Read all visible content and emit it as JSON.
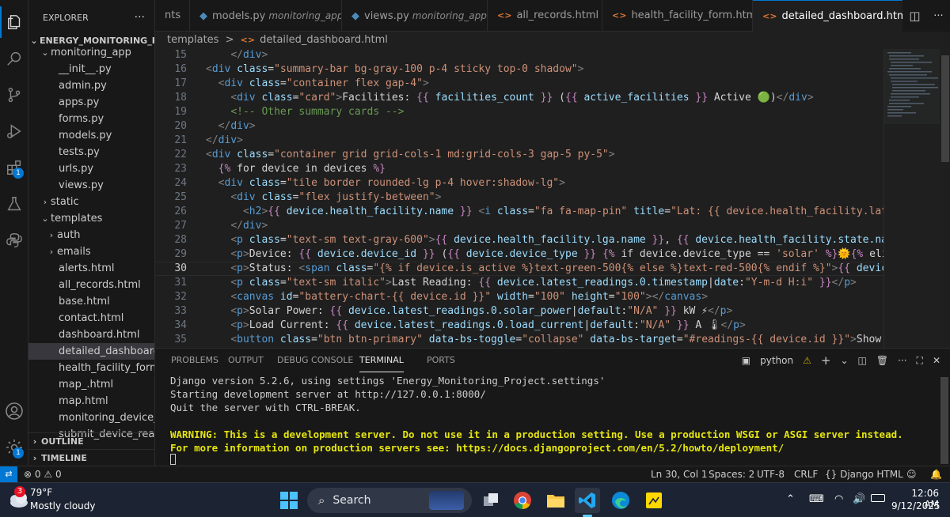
{
  "sidebar": {
    "title": "EXPLORER",
    "more": "···",
    "project": "ENERGY_MONITORING_PR...",
    "tree": [
      {
        "label": "monitoring_app",
        "type": "folder-open",
        "indent": 1
      },
      {
        "label": "__init__.py",
        "type": "file",
        "indent": 2
      },
      {
        "label": "admin.py",
        "type": "file",
        "indent": 2
      },
      {
        "label": "apps.py",
        "type": "file",
        "indent": 2
      },
      {
        "label": "forms.py",
        "type": "file",
        "indent": 2
      },
      {
        "label": "models.py",
        "type": "file",
        "indent": 2
      },
      {
        "label": "tests.py",
        "type": "file",
        "indent": 2
      },
      {
        "label": "urls.py",
        "type": "file",
        "indent": 2
      },
      {
        "label": "views.py",
        "type": "file",
        "indent": 2
      },
      {
        "label": "static",
        "type": "folder",
        "indent": 1
      },
      {
        "label": "templates",
        "type": "folder-open",
        "indent": 1
      },
      {
        "label": "auth",
        "type": "folder",
        "indent": 2
      },
      {
        "label": "emails",
        "type": "folder",
        "indent": 2
      },
      {
        "label": "alerts.html",
        "type": "file",
        "indent": 2
      },
      {
        "label": "all_records.html",
        "type": "file",
        "indent": 2
      },
      {
        "label": "base.html",
        "type": "file",
        "indent": 2
      },
      {
        "label": "contact.html",
        "type": "file",
        "indent": 2
      },
      {
        "label": "dashboard.html",
        "type": "file",
        "indent": 2
      },
      {
        "label": "detailed_dashboard....",
        "type": "file",
        "indent": 2,
        "selected": true
      },
      {
        "label": "health_facility_form....",
        "type": "file",
        "indent": 2
      },
      {
        "label": "map_.html",
        "type": "file",
        "indent": 2
      },
      {
        "label": "map.html",
        "type": "file",
        "indent": 2
      },
      {
        "label": "monitoring_device_f...",
        "type": "file",
        "indent": 2
      },
      {
        "label": "submit_device_readi...",
        "type": "file",
        "indent": 2
      }
    ],
    "outline": "OUTLINE",
    "timeline": "TIMELINE"
  },
  "activity": {
    "extensions_badge": "1",
    "settings_badge": "1"
  },
  "tabs": [
    {
      "label": "nts",
      "sub": ""
    },
    {
      "label": "models.py",
      "sub": "monitoring_app",
      "kind": "py"
    },
    {
      "label": "views.py",
      "sub": "monitoring_app",
      "kind": "py"
    },
    {
      "label": "all_records.html",
      "sub": "",
      "kind": "html"
    },
    {
      "label": "health_facility_form.html",
      "sub": "",
      "kind": "html"
    },
    {
      "label": "detailed_dashboard.html",
      "sub": "",
      "kind": "html",
      "active": true
    }
  ],
  "breadcrumb": {
    "folder": "templates",
    "sep": ">",
    "file": "detailed_dashboard.html"
  },
  "editor": {
    "current_line": 30,
    "lines": [
      {
        "n": "15",
        "ind": "    ",
        "segs": [
          [
            "t",
            "</"
          ],
          [
            "tg",
            "div"
          ],
          [
            "t",
            ">"
          ]
        ]
      },
      {
        "n": "16",
        "ind": "",
        "segs": [
          [
            "t",
            "<"
          ],
          [
            "tg",
            "div"
          ],
          [
            "at",
            " class"
          ],
          [
            "tx",
            "="
          ],
          [
            "st",
            "\"summary-bar bg-gray-100 p-4 sticky top-0 shadow\""
          ],
          [
            "t",
            ">"
          ]
        ]
      },
      {
        "n": "17",
        "ind": "  ",
        "segs": [
          [
            "t",
            "<"
          ],
          [
            "tg",
            "div"
          ],
          [
            "at",
            " class"
          ],
          [
            "tx",
            "="
          ],
          [
            "st",
            "\"container flex gap-4\""
          ],
          [
            "t",
            ">"
          ]
        ]
      },
      {
        "n": "18",
        "ind": "    ",
        "segs": [
          [
            "t",
            "<"
          ],
          [
            "tg",
            "div"
          ],
          [
            "at",
            " class"
          ],
          [
            "tx",
            "="
          ],
          [
            "st",
            "\"card\""
          ],
          [
            "t",
            ">"
          ],
          [
            "tx",
            "Facilities: "
          ],
          [
            "dj",
            "{{"
          ],
          [
            "at",
            " facilities_count "
          ],
          [
            "dj",
            "}}"
          ],
          [
            "tx",
            " ("
          ],
          [
            "dj",
            "{{"
          ],
          [
            "at",
            " active_facilities "
          ],
          [
            "dj",
            "}}"
          ],
          [
            "tx",
            " Active 🟢)"
          ],
          [
            "t",
            "</"
          ],
          [
            "tg",
            "div"
          ],
          [
            "t",
            ">"
          ]
        ]
      },
      {
        "n": "19",
        "ind": "    ",
        "segs": [
          [
            "cm",
            "<!-- Other summary cards -->"
          ]
        ]
      },
      {
        "n": "20",
        "ind": "  ",
        "segs": [
          [
            "t",
            "</"
          ],
          [
            "tg",
            "div"
          ],
          [
            "t",
            ">"
          ]
        ]
      },
      {
        "n": "21",
        "ind": "",
        "segs": [
          [
            "t",
            "</"
          ],
          [
            "tg",
            "div"
          ],
          [
            "t",
            ">"
          ]
        ]
      },
      {
        "n": "22",
        "ind": "",
        "segs": [
          [
            "t",
            "<"
          ],
          [
            "tg",
            "div"
          ],
          [
            "at",
            " class"
          ],
          [
            "tx",
            "="
          ],
          [
            "st",
            "\"container grid grid-cols-1 md:grid-cols-3 gap-5 py-5\""
          ],
          [
            "t",
            ">"
          ]
        ]
      },
      {
        "n": "23",
        "ind": "  ",
        "segs": [
          [
            "dj",
            "{%"
          ],
          [
            "tx",
            " for device in devices "
          ],
          [
            "dj",
            "%}"
          ]
        ]
      },
      {
        "n": "24",
        "ind": "  ",
        "segs": [
          [
            "t",
            "<"
          ],
          [
            "tg",
            "div"
          ],
          [
            "at",
            " class"
          ],
          [
            "tx",
            "="
          ],
          [
            "st",
            "\"tile border rounded-lg p-4 hover:shadow-lg\""
          ],
          [
            "t",
            ">"
          ]
        ]
      },
      {
        "n": "25",
        "ind": "    ",
        "segs": [
          [
            "t",
            "<"
          ],
          [
            "tg",
            "div"
          ],
          [
            "at",
            " class"
          ],
          [
            "tx",
            "="
          ],
          [
            "st",
            "\"flex justify-between\""
          ],
          [
            "t",
            ">"
          ]
        ]
      },
      {
        "n": "26",
        "ind": "      ",
        "segs": [
          [
            "t",
            "<"
          ],
          [
            "tg",
            "h2"
          ],
          [
            "t",
            ">"
          ],
          [
            "dj",
            "{{"
          ],
          [
            "at",
            " device.health_facility.name "
          ],
          [
            "dj",
            "}}"
          ],
          [
            "t",
            " <"
          ],
          [
            "tg",
            "i"
          ],
          [
            "at",
            " class"
          ],
          [
            "tx",
            "="
          ],
          [
            "st",
            "\"fa fa-map-pin\""
          ],
          [
            "at",
            " title"
          ],
          [
            "tx",
            "="
          ],
          [
            "st",
            "\"Lat: {{ device.health_facility.latitude }"
          ]
        ]
      },
      {
        "n": "27",
        "ind": "    ",
        "segs": [
          [
            "t",
            "</"
          ],
          [
            "tg",
            "div"
          ],
          [
            "t",
            ">"
          ]
        ]
      },
      {
        "n": "28",
        "ind": "    ",
        "segs": [
          [
            "t",
            "<"
          ],
          [
            "tg",
            "p"
          ],
          [
            "at",
            " class"
          ],
          [
            "tx",
            "="
          ],
          [
            "st",
            "\"text-sm text-gray-600\""
          ],
          [
            "t",
            ">"
          ],
          [
            "dj",
            "{{"
          ],
          [
            "at",
            " device.health_facility.lga.name "
          ],
          [
            "dj",
            "}}"
          ],
          [
            "tx",
            ", "
          ],
          [
            "dj",
            "{{"
          ],
          [
            "at",
            " device.health_facility.state.name "
          ],
          [
            "dj",
            "}}"
          ],
          [
            "t",
            "</"
          ]
        ]
      },
      {
        "n": "29",
        "ind": "    ",
        "segs": [
          [
            "t",
            "<"
          ],
          [
            "tg",
            "p"
          ],
          [
            "t",
            ">"
          ],
          [
            "tx",
            "Device: "
          ],
          [
            "dj",
            "{{"
          ],
          [
            "at",
            " device.device_id "
          ],
          [
            "dj",
            "}}"
          ],
          [
            "tx",
            " ("
          ],
          [
            "dj",
            "{{"
          ],
          [
            "at",
            " device.device_type "
          ],
          [
            "dj",
            "}}"
          ],
          [
            "tx",
            " "
          ],
          [
            "dj",
            "{%"
          ],
          [
            "tx",
            " if device.device_type == "
          ],
          [
            "st",
            "'solar'"
          ],
          [
            "tx",
            " "
          ],
          [
            "dj",
            "%}"
          ],
          [
            "tx",
            "🌞"
          ],
          [
            "dj",
            "{%"
          ],
          [
            "tx",
            " elif devic"
          ]
        ]
      },
      {
        "n": "30",
        "ind": "    ",
        "segs": [
          [
            "t",
            "<"
          ],
          [
            "tg",
            "p"
          ],
          [
            "t",
            ">"
          ],
          [
            "tx",
            "Status: "
          ],
          [
            "t",
            "<"
          ],
          [
            "tg",
            "span"
          ],
          [
            "at",
            " class"
          ],
          [
            "tx",
            "="
          ],
          [
            "st",
            "\"{% if device.is_active %}text-green-500{% else %}text-red-500{% endif %}\""
          ],
          [
            "t",
            ">"
          ],
          [
            "dj",
            "{{"
          ],
          [
            "at",
            " device.healt"
          ]
        ]
      },
      {
        "n": "31",
        "ind": "    ",
        "segs": [
          [
            "t",
            "<"
          ],
          [
            "tg",
            "p"
          ],
          [
            "at",
            " class"
          ],
          [
            "tx",
            "="
          ],
          [
            "st",
            "\"text-sm italic\""
          ],
          [
            "t",
            ">"
          ],
          [
            "tx",
            "Last Reading: "
          ],
          [
            "dj",
            "{{"
          ],
          [
            "at",
            " device.latest_readings.0.timestamp"
          ],
          [
            "tx",
            "|"
          ],
          [
            "at",
            "date"
          ],
          [
            "tx",
            ":"
          ],
          [
            "st",
            "\"Y-m-d H:i\""
          ],
          [
            "dj",
            " }}"
          ],
          [
            "t",
            "</"
          ],
          [
            "tg",
            "p"
          ],
          [
            "t",
            ">"
          ]
        ]
      },
      {
        "n": "32",
        "ind": "    ",
        "segs": [
          [
            "t",
            "<"
          ],
          [
            "tg",
            "canvas"
          ],
          [
            "at",
            " id"
          ],
          [
            "tx",
            "="
          ],
          [
            "st",
            "\"battery-chart-{{ device.id }}\""
          ],
          [
            "at",
            " width"
          ],
          [
            "tx",
            "="
          ],
          [
            "st",
            "\"100\""
          ],
          [
            "at",
            " height"
          ],
          [
            "tx",
            "="
          ],
          [
            "st",
            "\"100\""
          ],
          [
            "t",
            "></"
          ],
          [
            "tg",
            "canvas"
          ],
          [
            "t",
            ">"
          ]
        ]
      },
      {
        "n": "33",
        "ind": "    ",
        "segs": [
          [
            "t",
            "<"
          ],
          [
            "tg",
            "p"
          ],
          [
            "t",
            ">"
          ],
          [
            "tx",
            "Solar Power: "
          ],
          [
            "dj",
            "{{"
          ],
          [
            "at",
            " device.latest_readings.0.solar_power"
          ],
          [
            "tx",
            "|"
          ],
          [
            "at",
            "default"
          ],
          [
            "tx",
            ":"
          ],
          [
            "st",
            "\"N/A\""
          ],
          [
            "dj",
            " }}"
          ],
          [
            "tx",
            " kW ⚡"
          ],
          [
            "t",
            "</"
          ],
          [
            "tg",
            "p"
          ],
          [
            "t",
            ">"
          ]
        ]
      },
      {
        "n": "34",
        "ind": "    ",
        "segs": [
          [
            "t",
            "<"
          ],
          [
            "tg",
            "p"
          ],
          [
            "t",
            ">"
          ],
          [
            "tx",
            "Load Current: "
          ],
          [
            "dj",
            "{{"
          ],
          [
            "at",
            " device.latest_readings.0.load_current"
          ],
          [
            "tx",
            "|"
          ],
          [
            "at",
            "default"
          ],
          [
            "tx",
            ":"
          ],
          [
            "st",
            "\"N/A\""
          ],
          [
            "dj",
            " }}"
          ],
          [
            "tx",
            " A 🌡"
          ],
          [
            "t",
            "</"
          ],
          [
            "tg",
            "p"
          ],
          [
            "t",
            ">"
          ]
        ]
      },
      {
        "n": "35",
        "ind": "    ",
        "segs": [
          [
            "t",
            "<"
          ],
          [
            "tg",
            "button"
          ],
          [
            "at",
            " class"
          ],
          [
            "tx",
            "="
          ],
          [
            "st",
            "\"btn btn-primary\""
          ],
          [
            "at",
            " data-bs-toggle"
          ],
          [
            "tx",
            "="
          ],
          [
            "st",
            "\"collapse\""
          ],
          [
            "at",
            " data-bs-target"
          ],
          [
            "tx",
            "="
          ],
          [
            "st",
            "\"#readings-{{ device.id }}\""
          ],
          [
            "t",
            ">"
          ],
          [
            "tx",
            "Show Reading"
          ]
        ]
      }
    ]
  },
  "panel": {
    "tabs": [
      "PROBLEMS",
      "OUTPUT",
      "DEBUG CONSOLE",
      "TERMINAL",
      "PORTS"
    ],
    "active_tab": "TERMINAL",
    "terminal_name": "python",
    "terminal_lines": [
      {
        "text": "Django version 5.2.6, using settings 'Energy_Monitoring_Project.settings'",
        "warn": false
      },
      {
        "text": "Starting development server at http://127.0.0.1:8000/",
        "warn": false
      },
      {
        "text": "Quit the server with CTRL-BREAK.",
        "warn": false
      },
      {
        "text": "",
        "warn": false
      },
      {
        "text": "WARNING: This is a development server. Do not use it in a production setting. Use a production WSGI or ASGI server instead.",
        "warn": true
      },
      {
        "text": "For more information on production servers see: https://docs.djangoproject.com/en/5.2/howto/deployment/",
        "warn": true
      }
    ]
  },
  "statusbar": {
    "errors": "0",
    "warnings": "0",
    "position": "Ln 30, Col 1",
    "spaces": "Spaces: 2",
    "encoding": "UTF-8",
    "eol": "CRLF",
    "language": "{} Django HTML"
  },
  "taskbar": {
    "weather_badge": "3",
    "temperature": "79°F",
    "condition": "Mostly cloudy",
    "search_label": "Search",
    "time": "12:06 AM",
    "date": "9/12/2025"
  },
  "colors": {
    "accent": "#0078d4",
    "warning": "#e5e510",
    "selection": "#37373d"
  }
}
